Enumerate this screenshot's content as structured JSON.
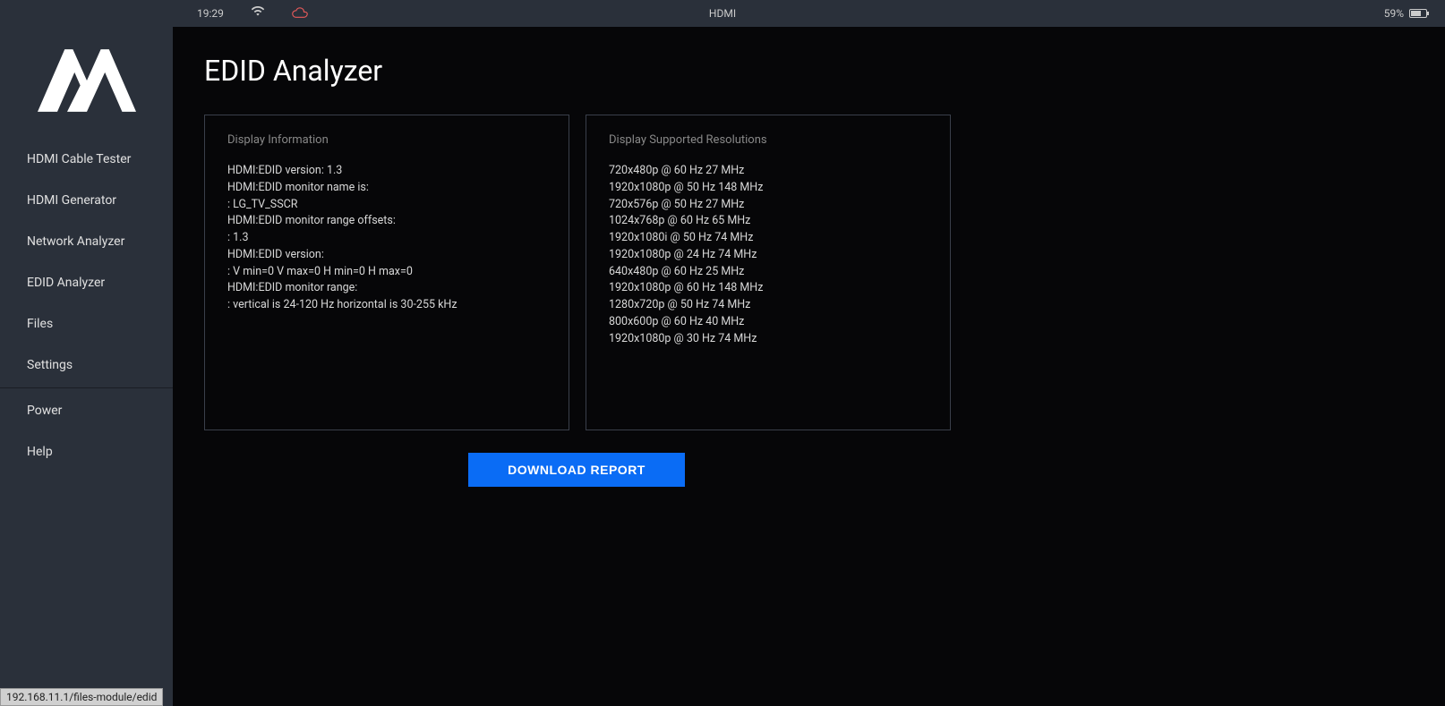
{
  "statusbar": {
    "time": "19:29",
    "center": "HDMI",
    "battery_pct": "59%"
  },
  "sidebar": {
    "items": [
      "HDMI Cable Tester",
      "HDMI Generator",
      "Network Analyzer",
      "EDID Analyzer",
      "Files",
      "Settings"
    ],
    "items2": [
      "Power",
      "Help"
    ]
  },
  "page": {
    "title": "EDID Analyzer",
    "panel1": {
      "title": "Display Information",
      "lines": [
        "HDMI:EDID version: 1.3",
        "HDMI:EDID monitor name is:",
        ": LG_TV_SSCR",
        "HDMI:EDID monitor range offsets:",
        ": 1.3",
        "HDMI:EDID version:",
        ": V min=0 V max=0 H min=0 H max=0",
        "HDMI:EDID monitor range:",
        ": vertical is 24-120 Hz horizontal is 30-255 kHz"
      ]
    },
    "panel2": {
      "title": "Display Supported Resolutions",
      "lines": [
        "720x480p @ 60 Hz 27 MHz",
        "1920x1080p @ 50 Hz 148 MHz",
        "720x576p @ 50 Hz 27 MHz",
        "1024x768p @ 60 Hz 65 MHz",
        "1920x1080i @ 50 Hz 74 MHz",
        "1920x1080p @ 24 Hz 74 MHz",
        "640x480p @ 60 Hz 25 MHz",
        "1920x1080p @ 60 Hz 148 MHz",
        "1280x720p @ 50 Hz 74 MHz",
        "800x600p @ 60 Hz 40 MHz",
        "1920x1080p @ 30 Hz 74 MHz"
      ]
    },
    "download_label": "DOWNLOAD REPORT"
  },
  "footer": {
    "url": "192.168.11.1/files-module/edid"
  }
}
